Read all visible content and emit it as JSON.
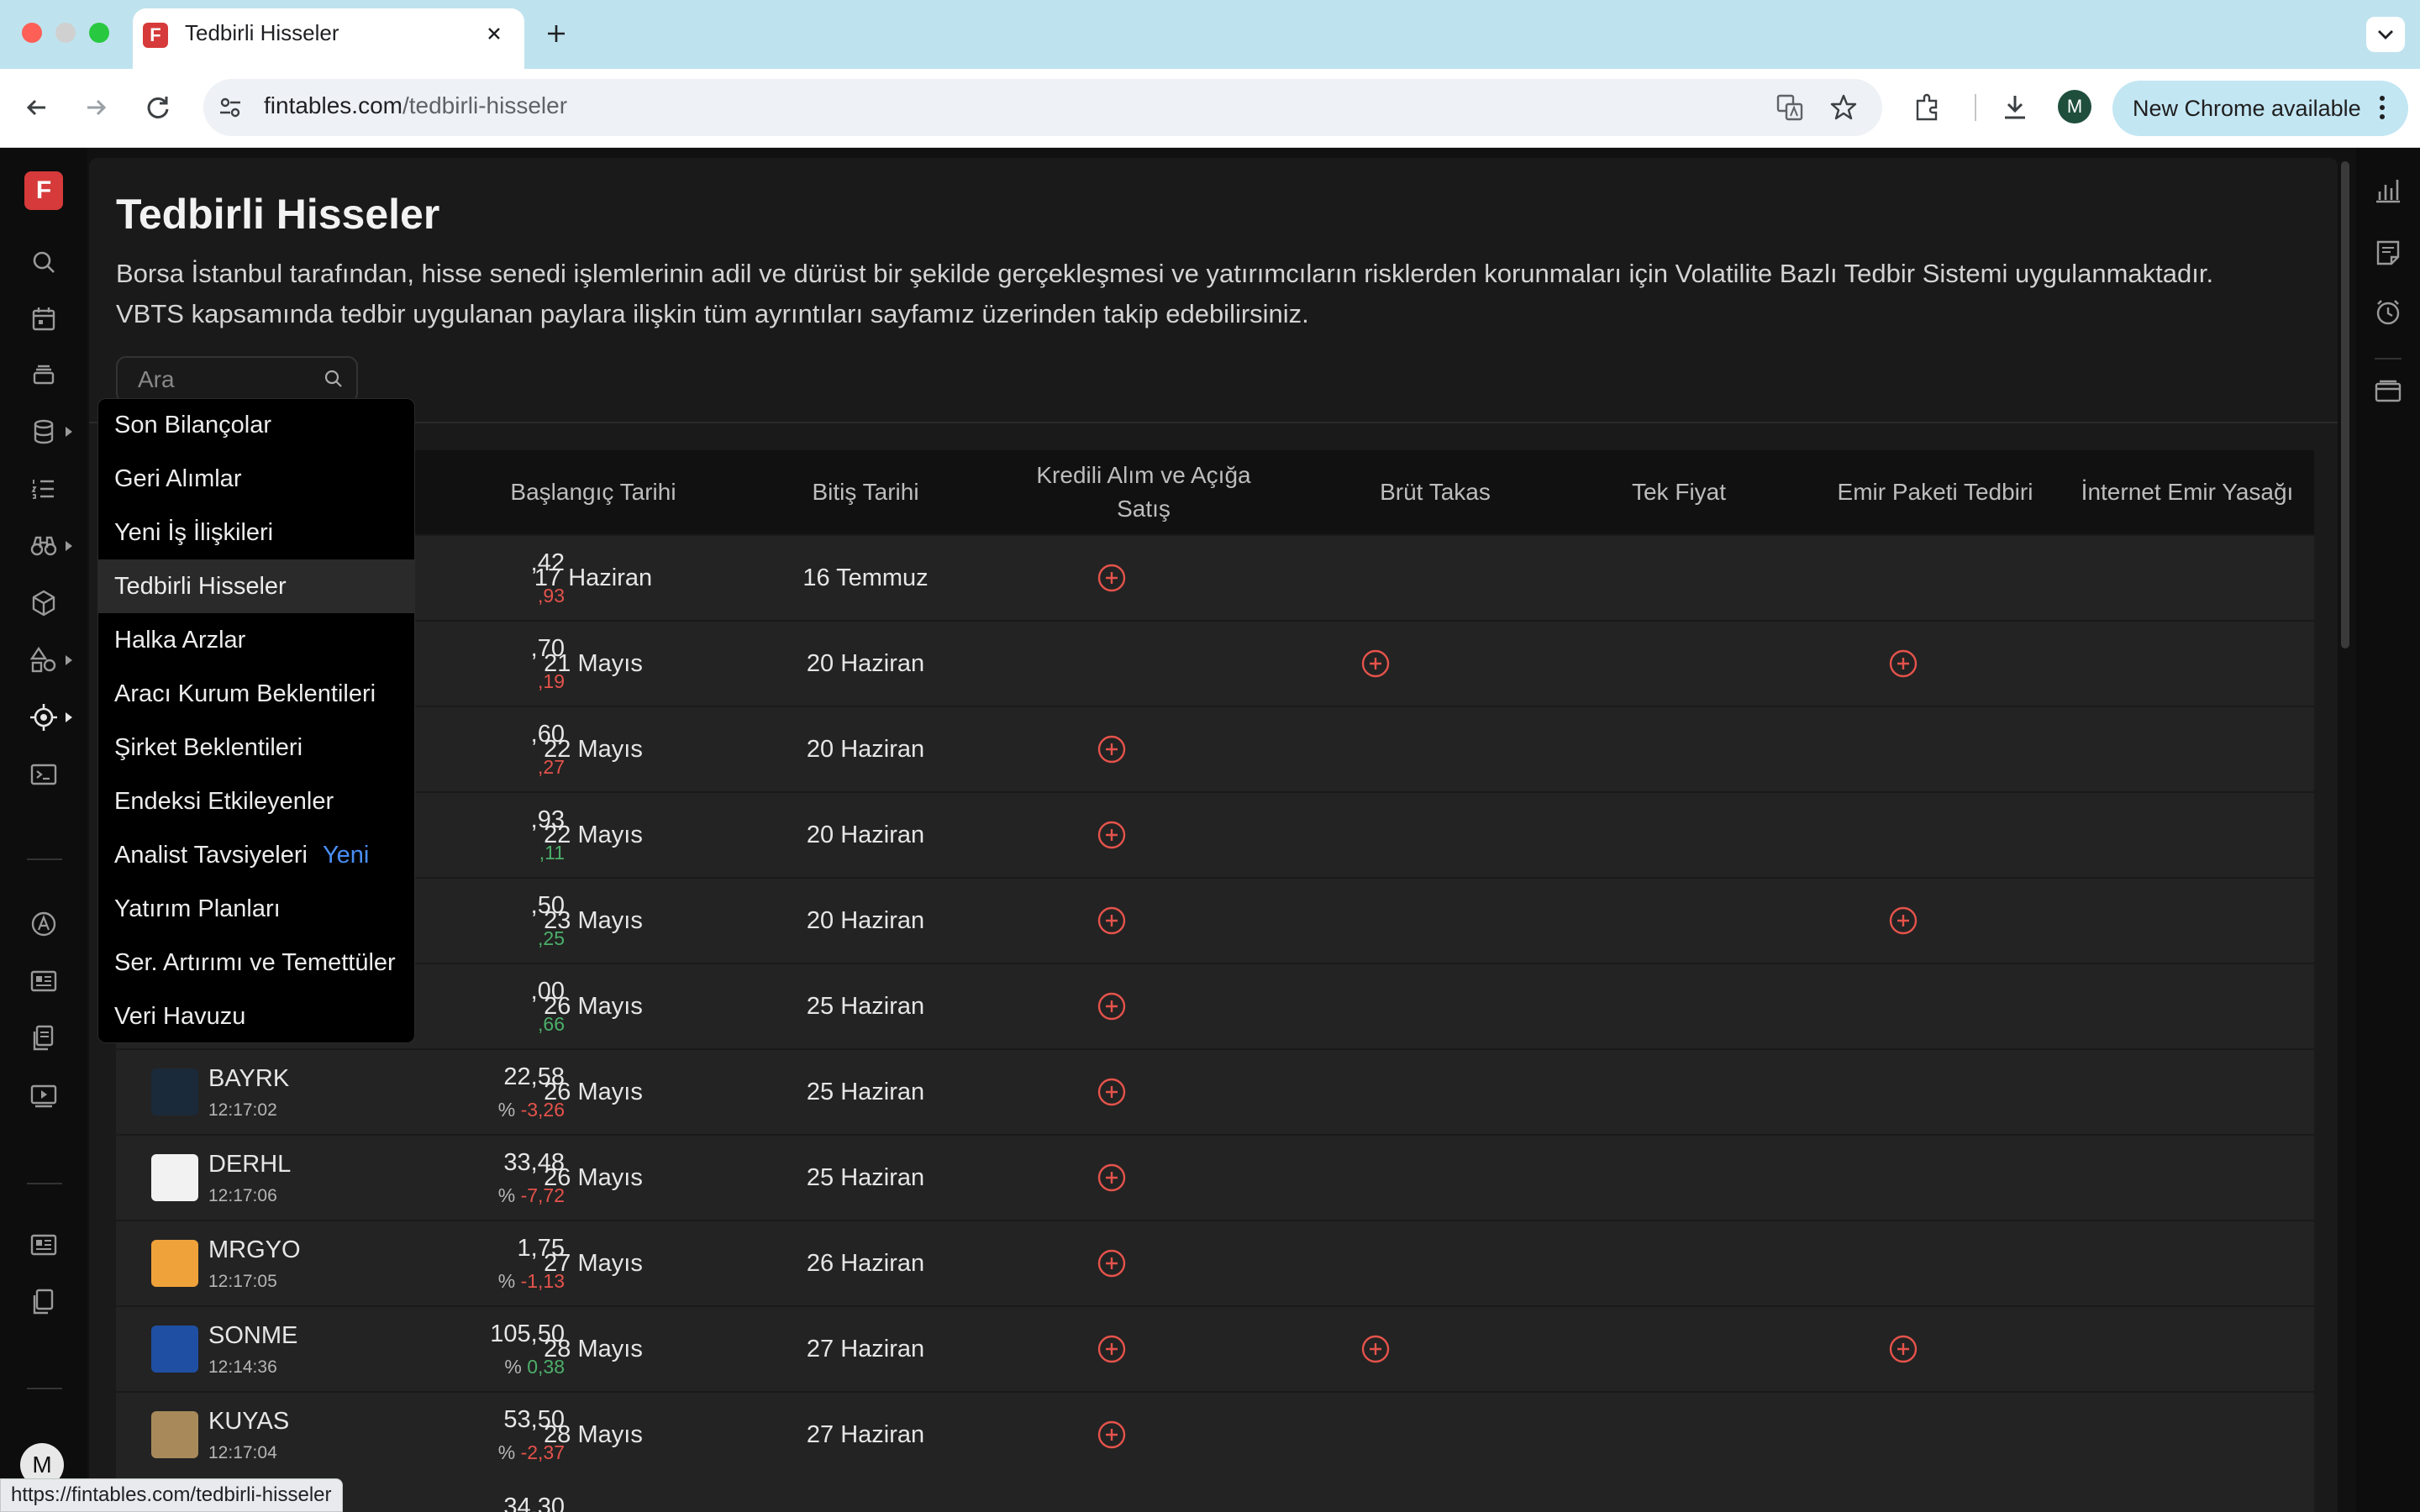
{
  "browser": {
    "tab_title": "Tedbirli Hisseler",
    "favicon_letter": "F",
    "url_host": "fintables.com",
    "url_path": "/tedbirli-hisseler",
    "update_label": "New Chrome available",
    "profile_initial": "M",
    "status_url": "https://fintables.com/tedbirli-hisseler"
  },
  "app": {
    "brand_letter": "F",
    "user_initial": "M",
    "accent_color": "#d63a3a"
  },
  "page": {
    "title": "Tedbirli Hisseler",
    "description": "Borsa İstanbul tarafından, hisse senedi işlemlerinin adil ve dürüst bir şekilde gerçekleşmesi ve yatırımcıların risklerden korunmaları için Volatilite Bazlı Tedbir Sistemi uygulanmaktadır. VBTS kapsamında tedbir uygulanan paylara ilişkin tüm ayrıntıları sayfamız üzerinden takip edebilirsiniz.",
    "search_placeholder": "Ara"
  },
  "menu": {
    "items": [
      "Son Bilançolar",
      "Geri Alımlar",
      "Yeni İş İlişkileri",
      "Tedbirli Hisseler",
      "Halka Arzlar",
      "Aracı Kurum Beklentileri",
      "Şirket Beklentileri",
      "Endeksi Etkileyenler",
      "Analist Tavsiyeleri",
      "Yatırım Planları",
      "Ser. Artırımı ve Temettüler",
      "Veri Havuzu"
    ],
    "active_index": 3,
    "new_badge": "Yeni"
  },
  "table": {
    "columns": {
      "start": "Başlangıç Tarihi",
      "end": "Bitiş Tarihi",
      "credit_line1": "Kredili Alım ve Açığa",
      "credit_line2": "Satış",
      "gross": "Brüt Takas",
      "single_price": "Tek Fiyat",
      "order_pkg": "Emir Paketi Tedbiri",
      "internet_ban": "İnternet Emir Yasağı"
    },
    "rows": [
      {
        "code": "",
        "time": "",
        "price": ",42",
        "pct": "",
        "change": ",93",
        "trend": "neg",
        "start": "17 Haziran",
        "end": "16 Temmuz",
        "flags": [
          true,
          false,
          false,
          false,
          false
        ]
      },
      {
        "code": "",
        "time": "",
        "price": ",70",
        "pct": "",
        "change": ",19",
        "trend": "neg",
        "start": "21 Mayıs",
        "end": "20 Haziran",
        "flags": [
          false,
          true,
          false,
          true,
          false
        ]
      },
      {
        "code": "",
        "time": "",
        "price": ",60",
        "pct": "",
        "change": ",27",
        "trend": "neg",
        "start": "22 Mayıs",
        "end": "20 Haziran",
        "flags": [
          true,
          false,
          false,
          false,
          false
        ]
      },
      {
        "code": "",
        "time": "",
        "price": ",93",
        "pct": "",
        "change": ",11",
        "trend": "pos",
        "start": "22 Mayıs",
        "end": "20 Haziran",
        "flags": [
          true,
          false,
          false,
          false,
          false
        ]
      },
      {
        "code": "",
        "time": "",
        "price": ",50",
        "pct": "",
        "change": ",25",
        "trend": "pos",
        "start": "23 Mayıs",
        "end": "20 Haziran",
        "flags": [
          true,
          false,
          false,
          true,
          false
        ]
      },
      {
        "code": "",
        "time": "",
        "price": ",00",
        "pct": "",
        "change": ",66",
        "trend": "pos",
        "start": "26 Mayıs",
        "end": "25 Haziran",
        "flags": [
          true,
          false,
          false,
          false,
          false
        ]
      },
      {
        "code": "BAYRK",
        "time": "12:17:02",
        "price": "22,58",
        "pct": "%",
        "change": "-3,26",
        "trend": "neg",
        "logo": "#1b2a3a",
        "start": "26 Mayıs",
        "end": "25 Haziran",
        "flags": [
          true,
          false,
          false,
          false,
          false
        ]
      },
      {
        "code": "DERHL",
        "time": "12:17:06",
        "price": "33,48",
        "pct": "%",
        "change": "-7,72",
        "trend": "neg",
        "logo": "#f2f2f2",
        "start": "26 Mayıs",
        "end": "25 Haziran",
        "flags": [
          true,
          false,
          false,
          false,
          false
        ]
      },
      {
        "code": "MRGYO",
        "time": "12:17:05",
        "price": "1,75",
        "pct": "%",
        "change": "-1,13",
        "trend": "neg",
        "logo": "#f0a23a",
        "start": "27 Mayıs",
        "end": "26 Haziran",
        "flags": [
          true,
          false,
          false,
          false,
          false
        ]
      },
      {
        "code": "SONME",
        "time": "12:14:36",
        "price": "105,50",
        "pct": "%",
        "change": "0,38",
        "trend": "pos",
        "logo": "#1f4fa3",
        "start": "28 Mayıs",
        "end": "27 Haziran",
        "flags": [
          true,
          true,
          false,
          true,
          false
        ]
      },
      {
        "code": "KUYAS",
        "time": "12:17:04",
        "price": "53,50",
        "pct": "%",
        "change": "-2,37",
        "trend": "neg",
        "logo": "#a88a5a",
        "start": "28 Mayıs",
        "end": "27 Haziran",
        "flags": [
          true,
          false,
          false,
          false,
          false
        ]
      }
    ],
    "partial_next_price": "34,30"
  }
}
